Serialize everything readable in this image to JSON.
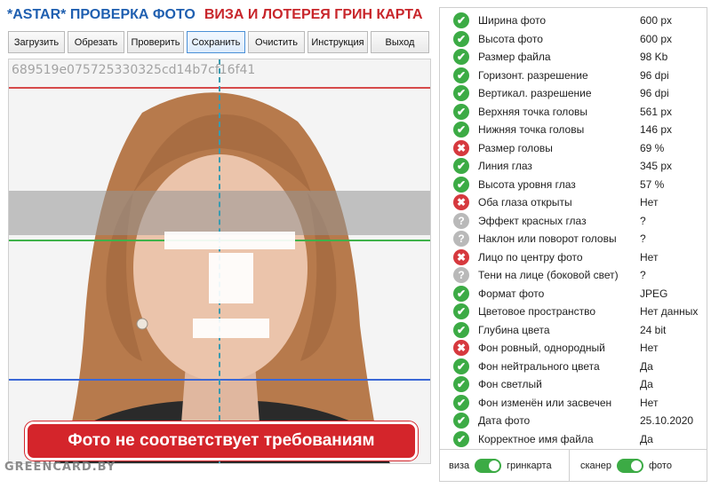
{
  "header": {
    "brand": "*ASTAR* ПРОВЕРКА ФОТО",
    "subtitle": "ВИЗА И ЛОТЕРЕЯ ГРИН КАРТА",
    "brand_color": "#1f5fb0",
    "subtitle_color": "#c8262b"
  },
  "toolbar": {
    "load": "Загрузить",
    "crop": "Обрезать",
    "check": "Проверить",
    "save": "Сохранить",
    "clear": "Очистить",
    "instructions": "Инструкция",
    "exit": "Выход"
  },
  "photo": {
    "hash": "689519e075725330325cd14b7cf16f41",
    "verdict": "Фото не соответствует требованиям",
    "watermark": "GREENCARD.BY",
    "verdict_color": "#d4252b"
  },
  "checks": [
    {
      "label": "Ширина фото",
      "value": "600 px",
      "status": "ok"
    },
    {
      "label": "Высота фото",
      "value": "600 px",
      "status": "ok"
    },
    {
      "label": "Размер файла",
      "value": "98 Kb",
      "status": "ok"
    },
    {
      "label": "Горизонт. разрешение",
      "value": "96 dpi",
      "status": "ok"
    },
    {
      "label": "Вертикал. разрешение",
      "value": "96 dpi",
      "status": "ok"
    },
    {
      "label": "Верхняя точка головы",
      "value": "561 px",
      "status": "ok"
    },
    {
      "label": "Нижняя точка головы",
      "value": "146 px",
      "status": "ok"
    },
    {
      "label": "Размер головы",
      "value": "69 %",
      "status": "fail"
    },
    {
      "label": "Линия глаз",
      "value": "345 px",
      "status": "ok"
    },
    {
      "label": "Высота уровня глаз",
      "value": "57 %",
      "status": "ok"
    },
    {
      "label": "Оба глаза открыты",
      "value": "Нет",
      "status": "fail"
    },
    {
      "label": "Эффект красных глаз",
      "value": "?",
      "status": "unknown"
    },
    {
      "label": "Наклон или поворот головы",
      "value": "?",
      "status": "unknown"
    },
    {
      "label": "Лицо по центру фото",
      "value": "Нет",
      "status": "fail"
    },
    {
      "label": "Тени на лице (боковой свет)",
      "value": "?",
      "status": "unknown"
    },
    {
      "label": "Формат фото",
      "value": "JPEG",
      "status": "ok"
    },
    {
      "label": "Цветовое пространство",
      "value": "Нет данных",
      "status": "ok"
    },
    {
      "label": "Глубина цвета",
      "value": "24 bit",
      "status": "ok"
    },
    {
      "label": "Фон ровный, однородный",
      "value": "Нет",
      "status": "fail"
    },
    {
      "label": "Фон нейтрального цвета",
      "value": "Да",
      "status": "ok"
    },
    {
      "label": "Фон светлый",
      "value": "Да",
      "status": "ok"
    },
    {
      "label": "Фон изменён или засвечен",
      "value": "Нет",
      "status": "ok"
    },
    {
      "label": "Дата фото",
      "value": "25.10.2020",
      "status": "ok"
    },
    {
      "label": "Корректное имя файла",
      "value": "Да",
      "status": "ok"
    }
  ],
  "footer": {
    "left_off": "виза",
    "left_on": "гринкарта",
    "left_toggle_on": true,
    "right_off": "сканер",
    "right_on": "фото",
    "right_toggle_on": true
  },
  "colors": {
    "ok": "#3cab45",
    "fail": "#d6393e",
    "unknown": "#b9b9b9"
  }
}
